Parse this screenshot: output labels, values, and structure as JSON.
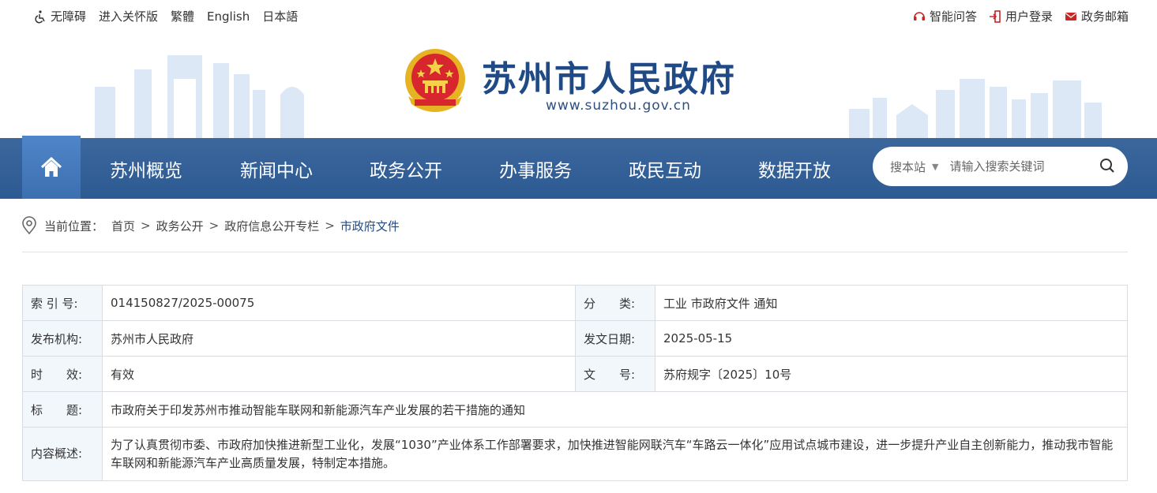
{
  "topbar": {
    "left": [
      {
        "label": "无障碍",
        "icon": "accessibility-icon"
      },
      {
        "label": "进入关怀版"
      },
      {
        "label": "繁體"
      },
      {
        "label": "English"
      },
      {
        "label": "日本語"
      }
    ],
    "right": [
      {
        "label": "智能问答",
        "icon": "headset-icon"
      },
      {
        "label": "用户登录",
        "icon": "login-icon"
      },
      {
        "label": "政务邮箱",
        "icon": "mail-icon"
      }
    ]
  },
  "header": {
    "title": "苏州市人民政府",
    "url": "www.suzhou.gov.cn"
  },
  "nav": {
    "items": [
      "苏州概览",
      "新闻中心",
      "政务公开",
      "办事服务",
      "政民互动",
      "数据开放"
    ]
  },
  "search": {
    "scope": "搜本站",
    "placeholder": "请输入搜索关键词"
  },
  "breadcrumb": {
    "label": "当前位置：",
    "items": [
      "首页",
      "政务公开",
      "政府信息公开专栏",
      "市政府文件"
    ],
    "separator": ">"
  },
  "info": {
    "index_label": "索 引 号:",
    "index_value": "014150827/2025-00075",
    "category_label": "分　　类:",
    "category_value": "工业 市政府文件 通知",
    "publisher_label": "发布机构:",
    "publisher_value": "苏州市人民政府",
    "date_label": "发文日期:",
    "date_value": "2025-05-15",
    "validity_label": "时　　效:",
    "validity_value": "有效",
    "docno_label": "文　　号:",
    "docno_value": "苏府规字〔2025〕10号",
    "title_label": "标　　题:",
    "title_value": "市政府关于印发苏州市推动智能车联网和新能源汽车产业发展的若干措施的通知",
    "summary_label": "内容概述:",
    "summary_value": "为了认真贯彻市委、市政府加快推进新型工业化，发展“1030”产业体系工作部署要求，加快推进智能网联汽车“车路云一体化”应用试点城市建设，进一步提升产业自主创新能力，推动我市智能车联网和新能源汽车产业高质量发展，特制定本措施。"
  },
  "colors": {
    "nav_bg": "#2d5a92",
    "home_bg": "#4a7fc1",
    "title_blue": "#1f4a86",
    "label_bg": "#f2f7fc"
  }
}
